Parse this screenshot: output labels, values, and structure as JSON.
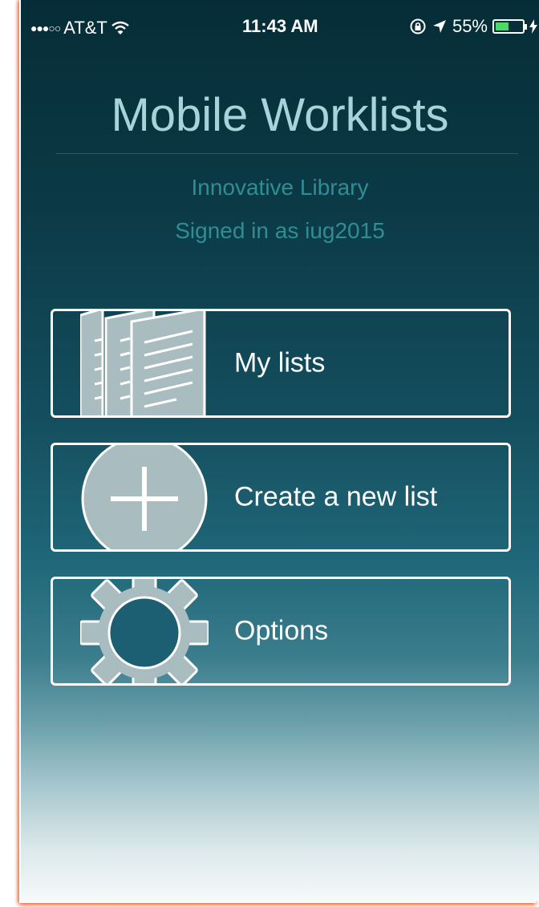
{
  "status_bar": {
    "signal": "●●●○○",
    "carrier": "AT&T",
    "wifi_icon": "wifi-icon",
    "time": "11:43 AM",
    "lock_icon": "orientation-lock-icon",
    "location_icon": "location-arrow-icon",
    "battery_percent": "55%",
    "battery_level": 0.55,
    "charging_icon": "lightning-icon"
  },
  "header": {
    "title": "Mobile Worklists",
    "library": "Innovative Library",
    "signed_in": "Signed in as iug2015"
  },
  "menu": [
    {
      "label": "My lists",
      "icon": "documents-icon"
    },
    {
      "label": "Create a new list",
      "icon": "plus-circle-icon"
    },
    {
      "label": "Options",
      "icon": "gear-icon"
    }
  ],
  "colors": {
    "title": "#a8d3db",
    "subtitle": "#2f8e93",
    "icon_fill": "#a9bcc0",
    "background_top": "#062d37"
  }
}
